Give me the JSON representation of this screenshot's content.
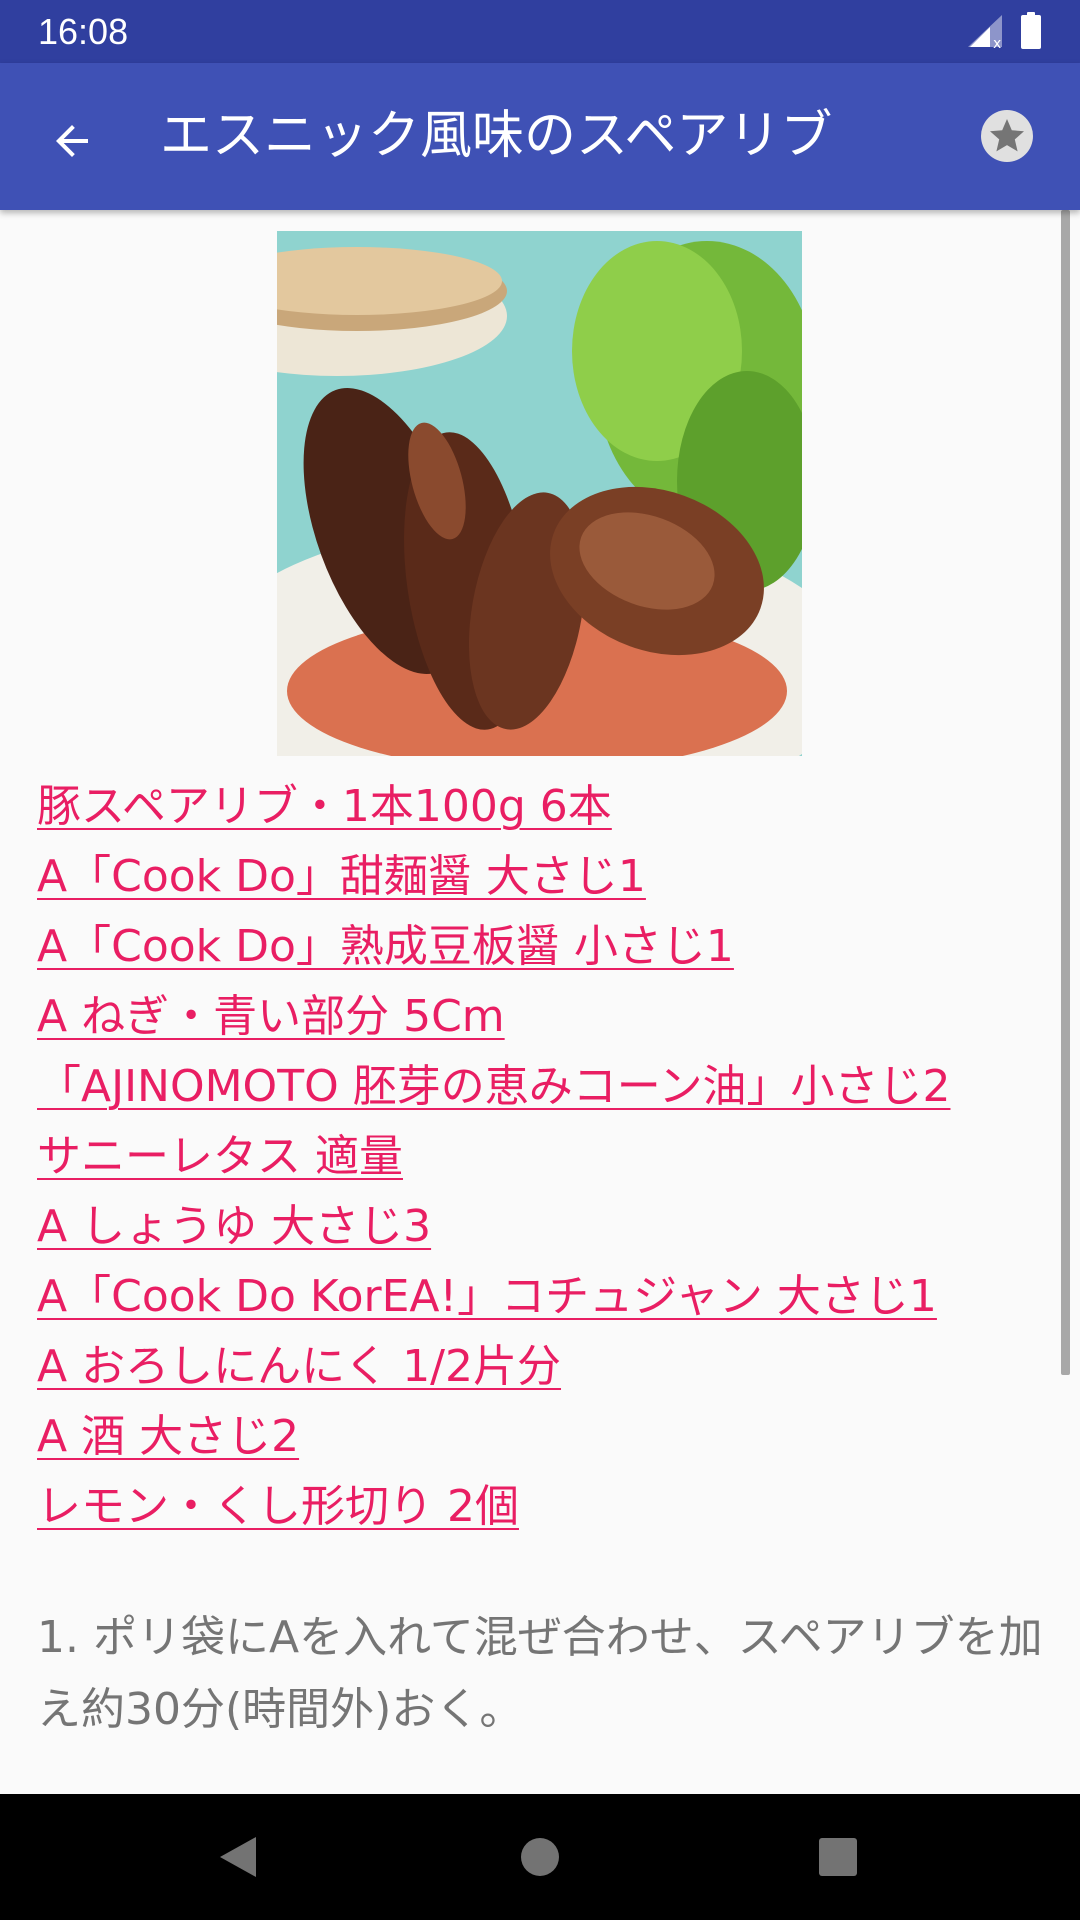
{
  "status_bar": {
    "time": "16:08",
    "icons": [
      "signal-no-data-icon",
      "battery-full-icon"
    ]
  },
  "app_bar": {
    "title": "エスニック風味のスペアリブ",
    "back_icon": "arrow-back-icon",
    "favorite_icon": "star-circle-icon"
  },
  "recipe": {
    "photo": "spare-ribs-photo",
    "ingredients": [
      "豚スペアリブ・1本100g 6本",
      "A「Cook Do」甜麺醤 大さじ1",
      "A「Cook Do」熟成豆板醤 小さじ1",
      "A ねぎ・青い部分 5Cm",
      "「AJINOMOTO 胚芽の恵みコーン油」小さじ2",
      "サニーレタス 適量",
      "A しょうゆ 大さじ3",
      "A「Cook Do KorEA!」コチュジャン 大さじ1",
      "A おろしにんにく 1/2片分",
      "A 酒 大さじ2",
      "レモン・くし形切り 2個"
    ],
    "step_1": "1. ポリ袋にAを入れて混ぜ合わせ、スペアリブを加え約30分(時間外)おく。",
    "link_color": "#e91e63"
  },
  "theme": {
    "primary": "#3f51b5",
    "primary_dark": "#303f9f",
    "background": "#fafafa"
  },
  "nav_bar": {
    "buttons": [
      "nav-back-icon",
      "nav-home-icon",
      "nav-recents-icon"
    ]
  }
}
